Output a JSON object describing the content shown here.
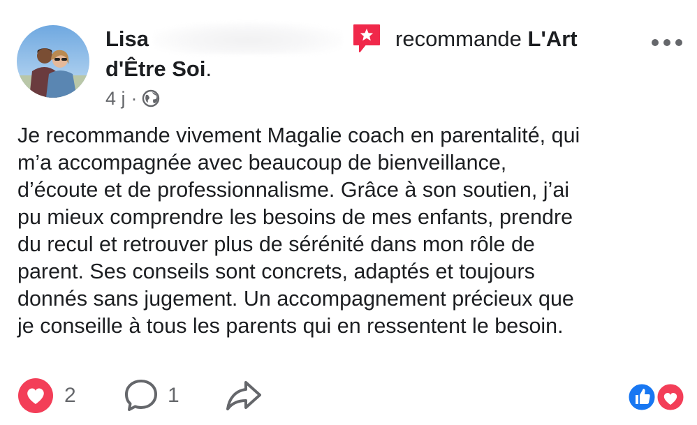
{
  "post": {
    "author": "Lisa",
    "recommend_verb": "recommande",
    "page_name_part1": "L'Art",
    "page_name_part2": "d'Être Soi",
    "page_name_end": ".",
    "time": "4 j",
    "separator": "·",
    "privacy_icon": "globe-icon",
    "body_lines": [
      "Je recommande vivement Magalie coach en parentalité, qui",
      "m’a accompagnée avec beaucoup de bienveillance,",
      "d’écoute et de professionnalisme. Grâce à son soutien, j’ai",
      "pu mieux comprendre les besoins de mes enfants, prendre",
      "du recul et retrouver plus de sérénité dans mon rôle de",
      "parent. Ses conseils sont concrets, adaptés et toujours",
      "donnés sans jugement. Un accompagnement précieux que",
      "je conseille à tous les parents qui en ressentent le besoin."
    ]
  },
  "actions": {
    "like_count": "2",
    "comment_count": "1",
    "like_icon": "heart-icon",
    "comment_icon": "comment-icon",
    "share_icon": "share-icon",
    "reaction_icons": [
      "like-icon",
      "love-icon"
    ]
  },
  "colors": {
    "recommend_red": "#f0284a",
    "love_red": "#f33e58",
    "like_blue": "#1877f2",
    "text_primary": "#1c1e21",
    "text_secondary": "#65676b"
  }
}
